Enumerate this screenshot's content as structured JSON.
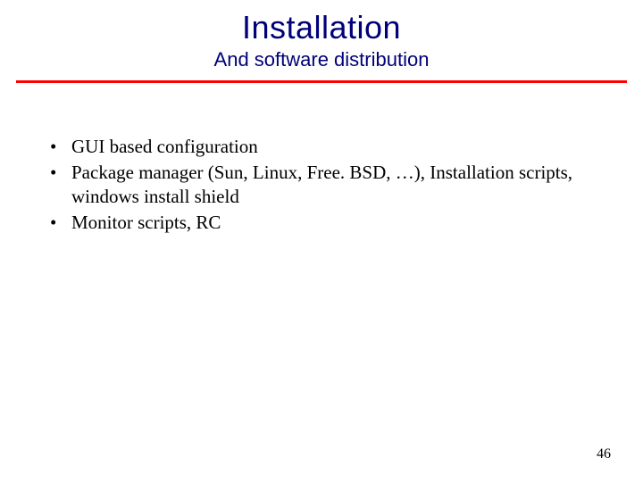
{
  "title": "Installation",
  "subtitle": "And software distribution",
  "bullets": [
    "GUI based configuration",
    "Package manager (Sun, Linux, Free. BSD, …), Installation scripts, windows install shield",
    "Monitor scripts, RC"
  ],
  "page_number": "46",
  "colors": {
    "title": "#00007a",
    "rule": "#ff0000"
  }
}
